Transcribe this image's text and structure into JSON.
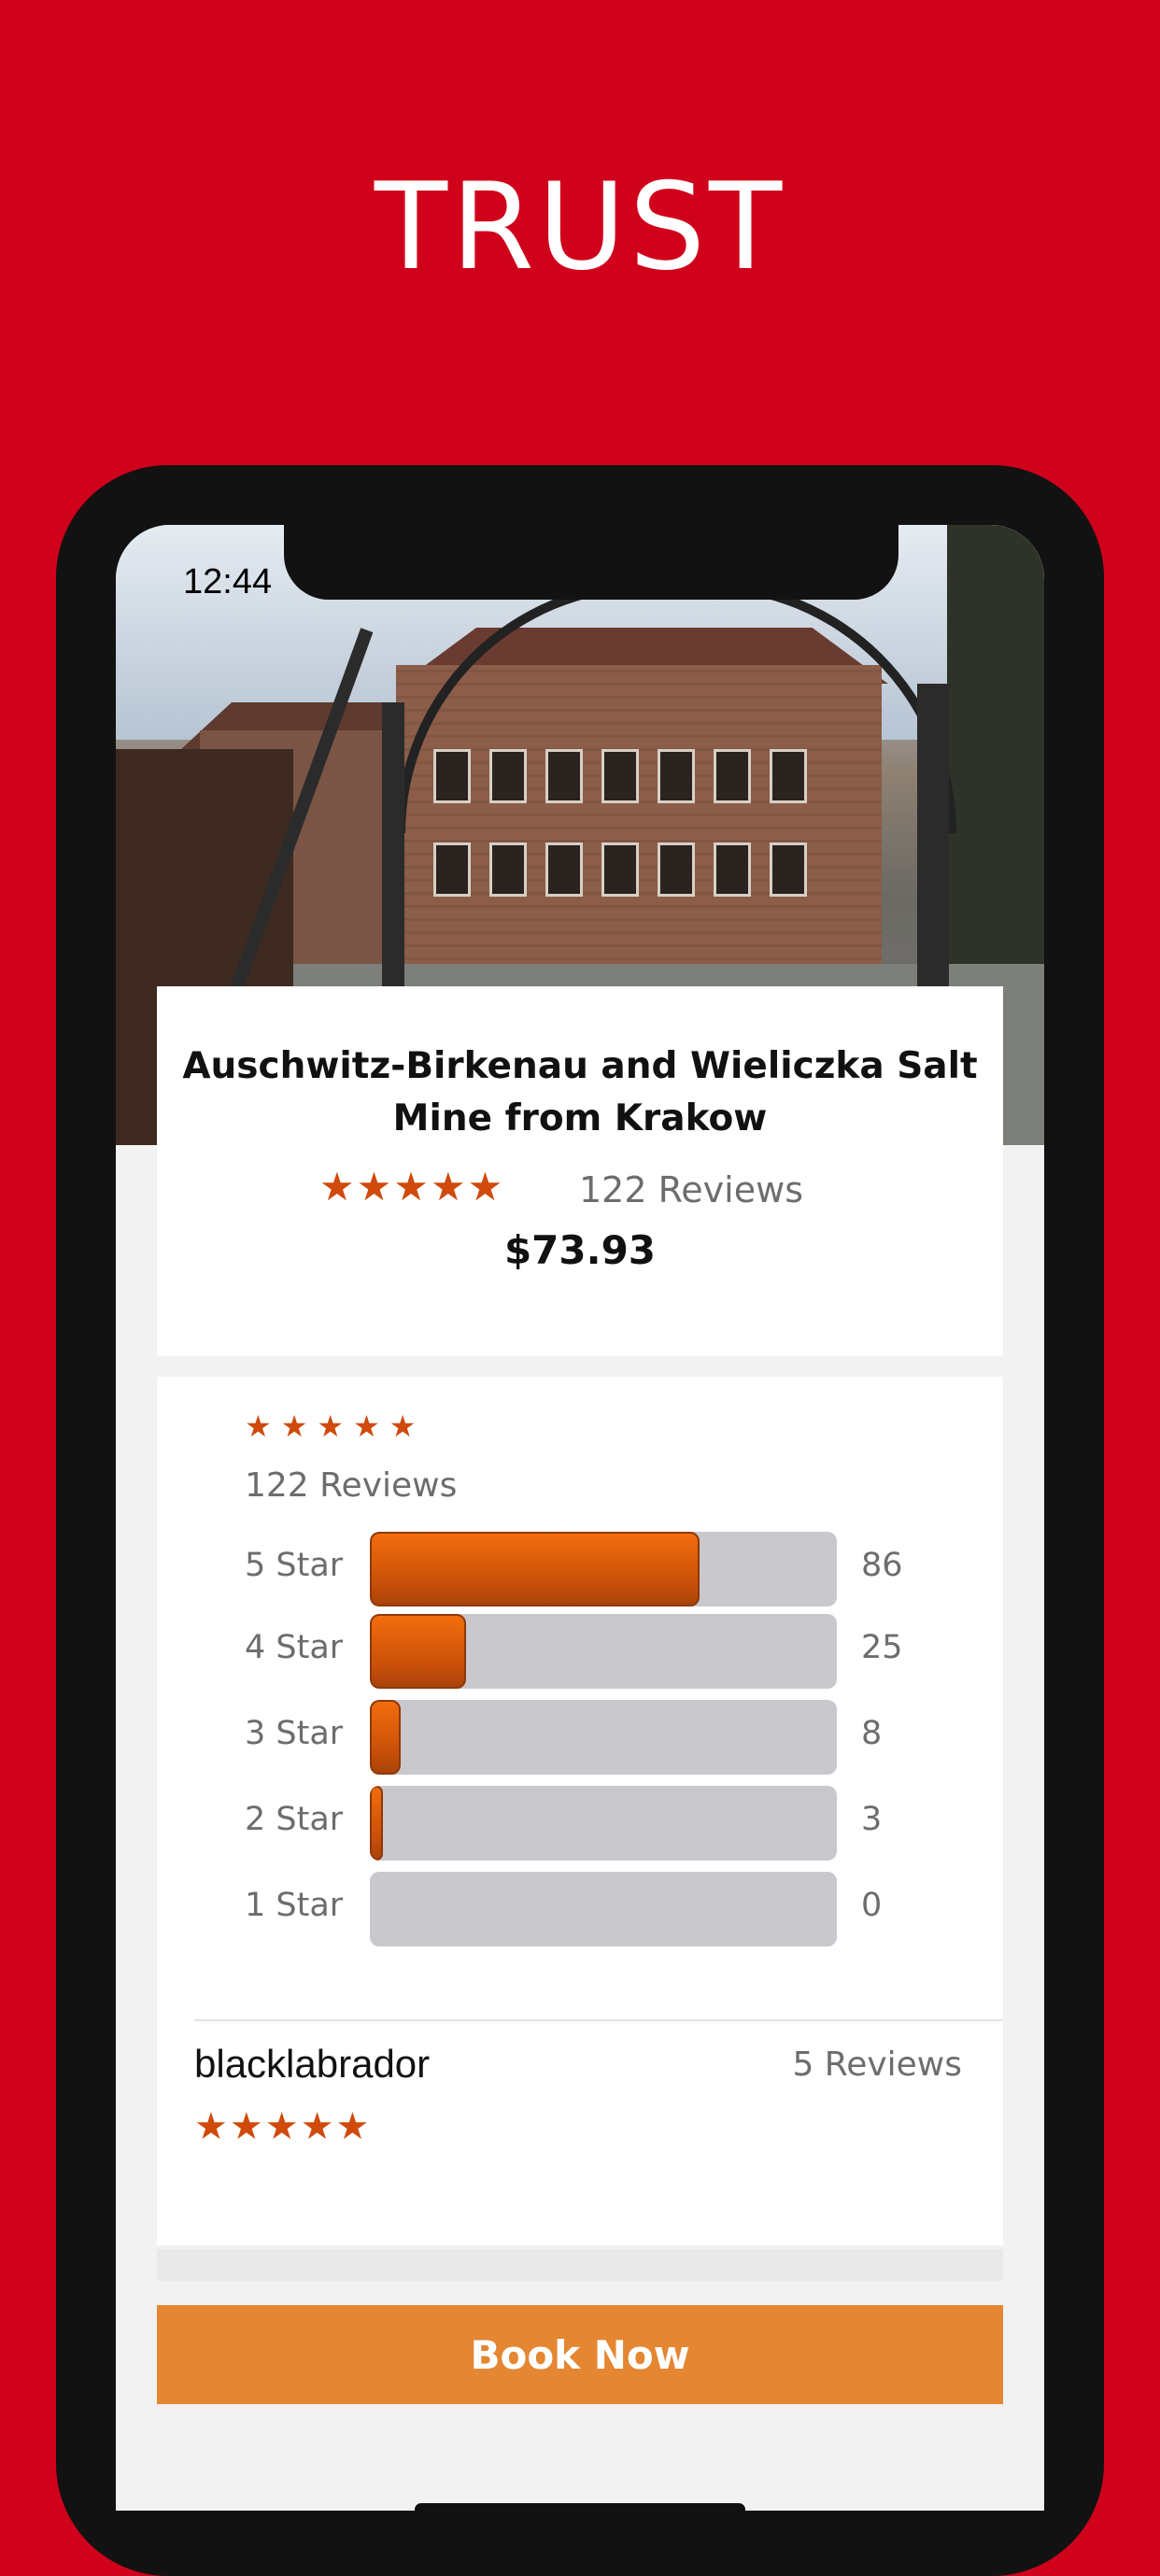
{
  "headline": "TRUST",
  "status": {
    "time": "12:44"
  },
  "tour": {
    "title": "Auschwitz-Birkenau and Wieliczka Salt Mine from Krakow",
    "stars": "★★★★★",
    "reviews": "122 Reviews",
    "price": "$73.93"
  },
  "rating_summary": {
    "stars": "★★★★★",
    "reviews": "122 Reviews",
    "rows": [
      {
        "label": "5 Star",
        "count": "86",
        "fraction": 0.705
      },
      {
        "label": "4 Star",
        "count": "25",
        "fraction": 0.205
      },
      {
        "label": "3 Star",
        "count": "8",
        "fraction": 0.066
      },
      {
        "label": "2 Star",
        "count": "3",
        "fraction": 0.025
      },
      {
        "label": "1 Star",
        "count": "0",
        "fraction": 0
      }
    ]
  },
  "review": {
    "author": "blacklabrador",
    "author_reviews": "5 Reviews",
    "stars": "★★★★★"
  },
  "cta": {
    "label": "Book Now"
  },
  "colors": {
    "background": "#d0021b",
    "star": "#cf4a0b",
    "button": "#e58632",
    "bar": "#e0620c"
  }
}
